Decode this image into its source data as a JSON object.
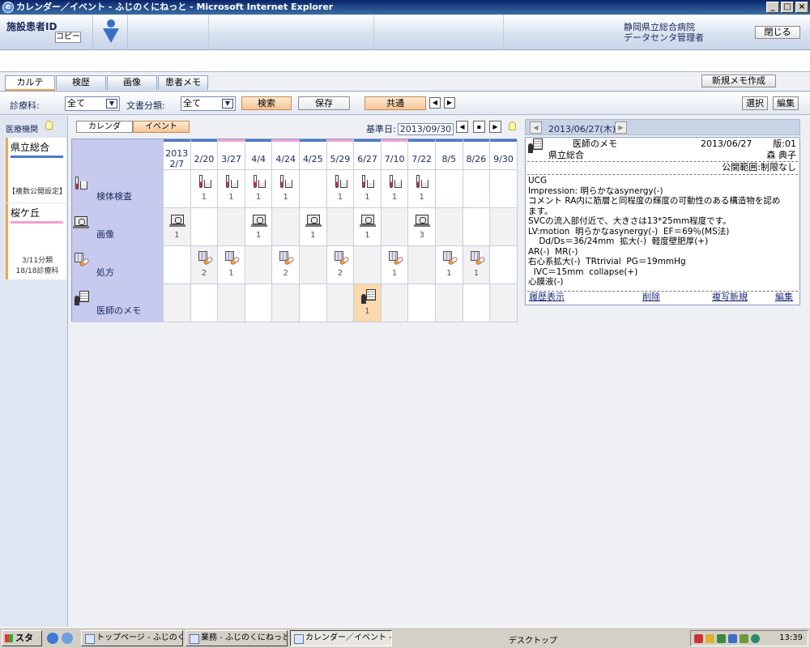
{
  "window": {
    "title": "カレンダー／イベント - ふじのくにねっと - Microsoft Internet Explorer",
    "min": "_",
    "max": "□",
    "close": "×"
  },
  "header": {
    "patient_id_label": "施設患者ID",
    "copy_label": "コピー",
    "hospital_line1": "静岡県立総合病院",
    "hospital_line2": "データセンタ管理者",
    "close_label": "閉じる"
  },
  "tabs": [
    "カルテ",
    "検歴",
    "画像",
    "患者メモ"
  ],
  "new_memo_label": "新規メモ作成",
  "toolbar": {
    "dept_label": "診療科:",
    "dept_value": "全て",
    "doctype_label": "文書分類:",
    "doctype_value": "全て",
    "search_label": "検索",
    "save_label": "保存",
    "shared_label": "共通",
    "select_label": "選択",
    "edit_label": "編集"
  },
  "sidebar": {
    "title": "医療機関",
    "institutions": [
      {
        "name": "県立総合",
        "note": "【複数公開設定】",
        "accent": "#4a7ac8"
      },
      {
        "name": "桜ケ丘",
        "note": "3/11分類\n18/18診療科",
        "accent": "#f2a0d0"
      }
    ]
  },
  "calendar": {
    "view_tabs": [
      "カレンダ",
      "イベント"
    ],
    "active_view": 1,
    "base_date_label": "基準日:",
    "base_date": "2013/09/30",
    "year": "2013",
    "dates": [
      "2/7",
      "2/20",
      "3/27",
      "4/4",
      "4/24",
      "4/25",
      "5/29",
      "6/27",
      "7/10",
      "7/22",
      "8/5",
      "8/26",
      "9/30"
    ],
    "stripes": [
      "#4a7ac8",
      "#4a7ac8",
      "#f2a0d0",
      "#4a7ac8",
      "#f2a0d0",
      "#4a7ac8",
      "#f2a0d0",
      "#4a7ac8",
      "#f2a0d0",
      "#4a7ac8",
      "#4a7ac8",
      "#4a7ac8",
      "#4a7ac8"
    ],
    "rows": [
      {
        "label": "検体検査",
        "icon": "test",
        "counts": [
          null,
          "1",
          "1",
          "1",
          "1",
          null,
          "1",
          "1",
          "1",
          "1",
          null,
          null,
          null
        ]
      },
      {
        "label": "画像",
        "icon": "img",
        "counts": [
          "1",
          null,
          null,
          "1",
          null,
          "1",
          null,
          "1",
          null,
          "3",
          null,
          null,
          null
        ]
      },
      {
        "label": "処方",
        "icon": "rx",
        "counts": [
          null,
          "2",
          "1",
          null,
          "2",
          null,
          "2",
          null,
          "1",
          null,
          "1",
          "1",
          null
        ]
      },
      {
        "label": "医師のメモ",
        "icon": "memo",
        "counts": [
          null,
          null,
          null,
          null,
          null,
          null,
          null,
          "1",
          null,
          null,
          null,
          null,
          null
        ]
      }
    ],
    "highlight_col": 7
  },
  "memo_panel": {
    "date": "2013/06/27(木)",
    "title": "医師のメモ",
    "memo_date": "2013/06/27",
    "version": "版:01",
    "facility": "県立総合",
    "author": "森 典子",
    "scope": "公開範囲:制限なし",
    "body": "UCG\nImpression: 明らかなasynergy(-)\nコメント RA内に筋層と同程度の輝度の可動性のある構造物を認め\nます。\nSVCの流入部付近で、大きさは13*25mm程度です。\nLV:motion  明らかなasynergy(-)  EF＝69％(MS法)\n    Dd/Ds＝36/24mm  拡大(-)  軽度壁肥厚(+)\nAR(-)  MR(-)\n右心系拡大(-)  TRtrivial  PG＝19mmHg\n  IVC＝15mm  collapse(+)\n心膜液(-)",
    "links": [
      "履歴表示",
      "削除",
      "複写新規",
      "編集"
    ]
  },
  "taskbar": {
    "start": "スタート",
    "tasks": [
      "トップページ - ふじのくにね...",
      "業務 - ふじのくにねっと - ...",
      "カレンダー／イベント - ..."
    ],
    "desktop": "デスクトップ",
    "clock": "13:39"
  }
}
